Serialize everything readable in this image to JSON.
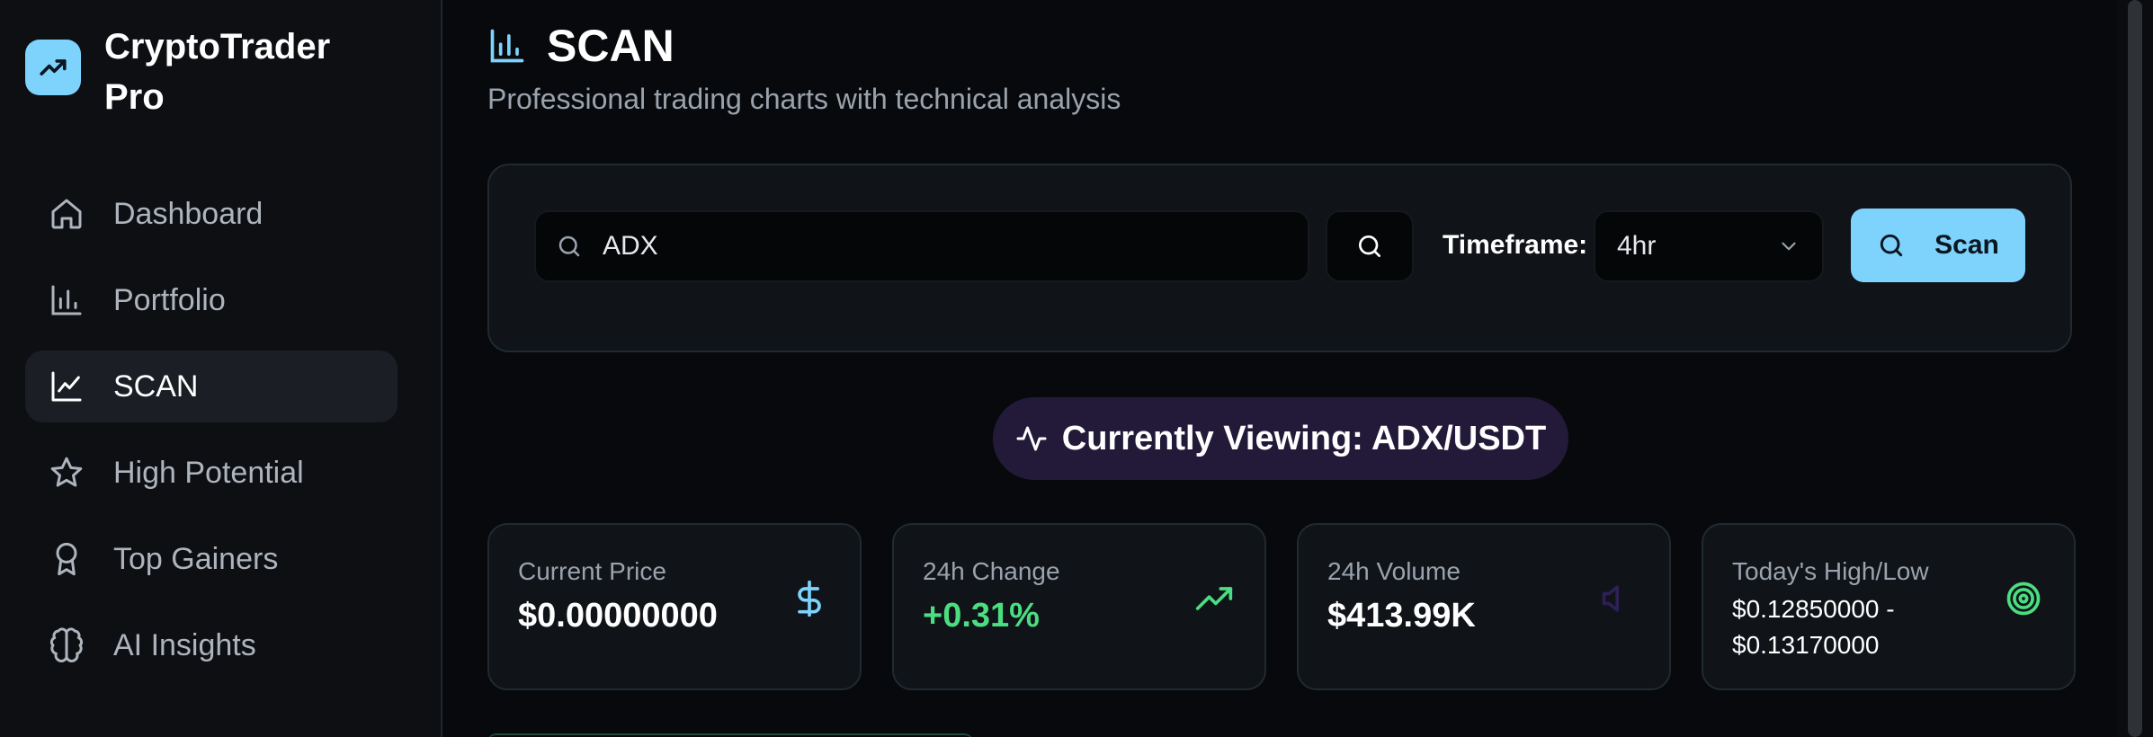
{
  "app": {
    "name": "CryptoTrader Pro",
    "accent": "#7dd3fc"
  },
  "sidebar": {
    "items": [
      {
        "label": "Dashboard",
        "icon": "home-icon",
        "active": false
      },
      {
        "label": "Portfolio",
        "icon": "bar-chart-icon",
        "active": false
      },
      {
        "label": "SCAN",
        "icon": "line-chart-icon",
        "active": true
      },
      {
        "label": "High Potential",
        "icon": "star-icon",
        "active": false
      },
      {
        "label": "Top Gainers",
        "icon": "award-icon",
        "active": false
      },
      {
        "label": "AI Insights",
        "icon": "brain-icon",
        "active": false
      }
    ]
  },
  "header": {
    "title": "SCAN",
    "subtitle": "Professional trading charts with technical analysis",
    "icon": "bar-chart-icon"
  },
  "scan": {
    "search_value": "ADX",
    "timeframe_label": "Timeframe:",
    "timeframe_value": "4hr",
    "scan_button": "Scan"
  },
  "viewing": {
    "text": "Currently Viewing: ADX/USDT",
    "icon": "activity-icon"
  },
  "stats": [
    {
      "label": "Current Price",
      "value": "$0.00000000",
      "icon": "dollar-icon",
      "color": "#7dd3fc"
    },
    {
      "label": "24h Change",
      "value": "+0.31%",
      "icon": "trending-up-icon",
      "color": "#4ade80"
    },
    {
      "label": "24h Volume",
      "value": "$413.99K",
      "icon": "volume-icon",
      "color": "#2e1f55"
    },
    {
      "label": "Today's High/Low",
      "value": "$0.12850000 - $0.13170000",
      "icon": "target-icon",
      "color": "#4ade80"
    }
  ]
}
